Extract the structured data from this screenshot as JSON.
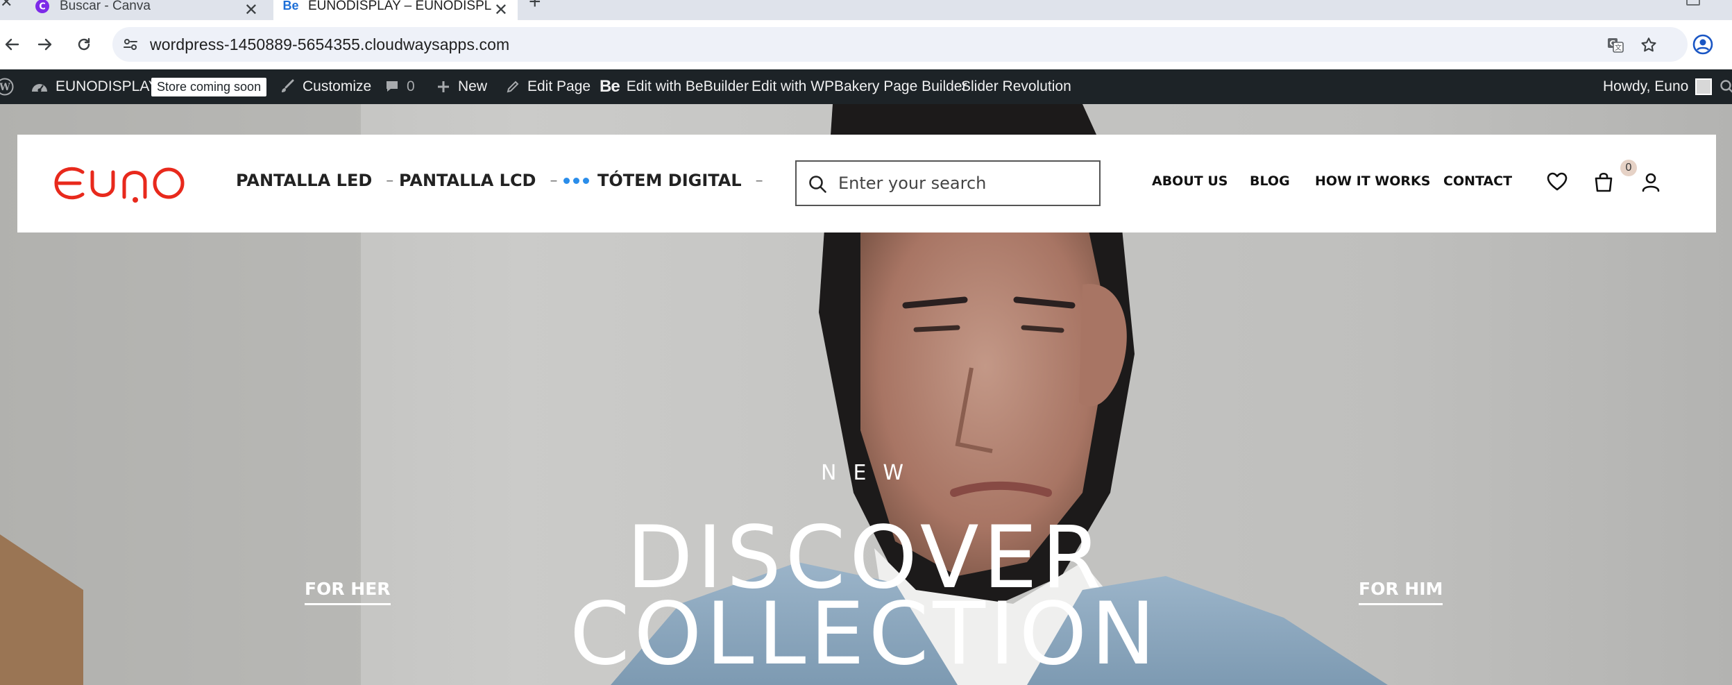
{
  "browser": {
    "tabs": [
      {
        "title": "Buscar - Canva",
        "active": false
      },
      {
        "title": "EUNODISPLAY – EUNODISPL",
        "active": true
      }
    ],
    "url": "wordpress-1450889-5654355.cloudwaysapps.com"
  },
  "admin_bar": {
    "site_name": "EUNODISPLAY",
    "store_badge": "Store coming soon",
    "customize": "Customize",
    "comments_count": "0",
    "new": "New",
    "edit_page": "Edit Page",
    "be_mark": "Be",
    "edit_bebuilder": "Edit with BeBuilder",
    "edit_wpbakery": "Edit with WPBakery Page Builder",
    "slider_revolution": "Slider Revolution",
    "howdy": "Howdy, Euno"
  },
  "header": {
    "nav": [
      {
        "label": "PANTALLA LED",
        "dash": "–"
      },
      {
        "label": "PANTALLA LCD",
        "dash": "–"
      },
      {
        "label": "TÓTEM DIGITAL",
        "dash": "–"
      }
    ],
    "search_placeholder": "Enter your search",
    "secondary_nav": [
      "ABOUT US",
      "BLOG",
      "HOW IT WORKS",
      "CONTACT"
    ],
    "cart_count": "0"
  },
  "hero": {
    "eyebrow": "NEW",
    "headline_line1": "DISCOVER",
    "headline_line2": "COLLECTION",
    "left_link": "FOR HER",
    "right_link": "FOR HIM"
  },
  "colors": {
    "brand_red": "#e8291c",
    "admin_bar": "#1d2327",
    "accent_blue": "#2a8dea"
  }
}
